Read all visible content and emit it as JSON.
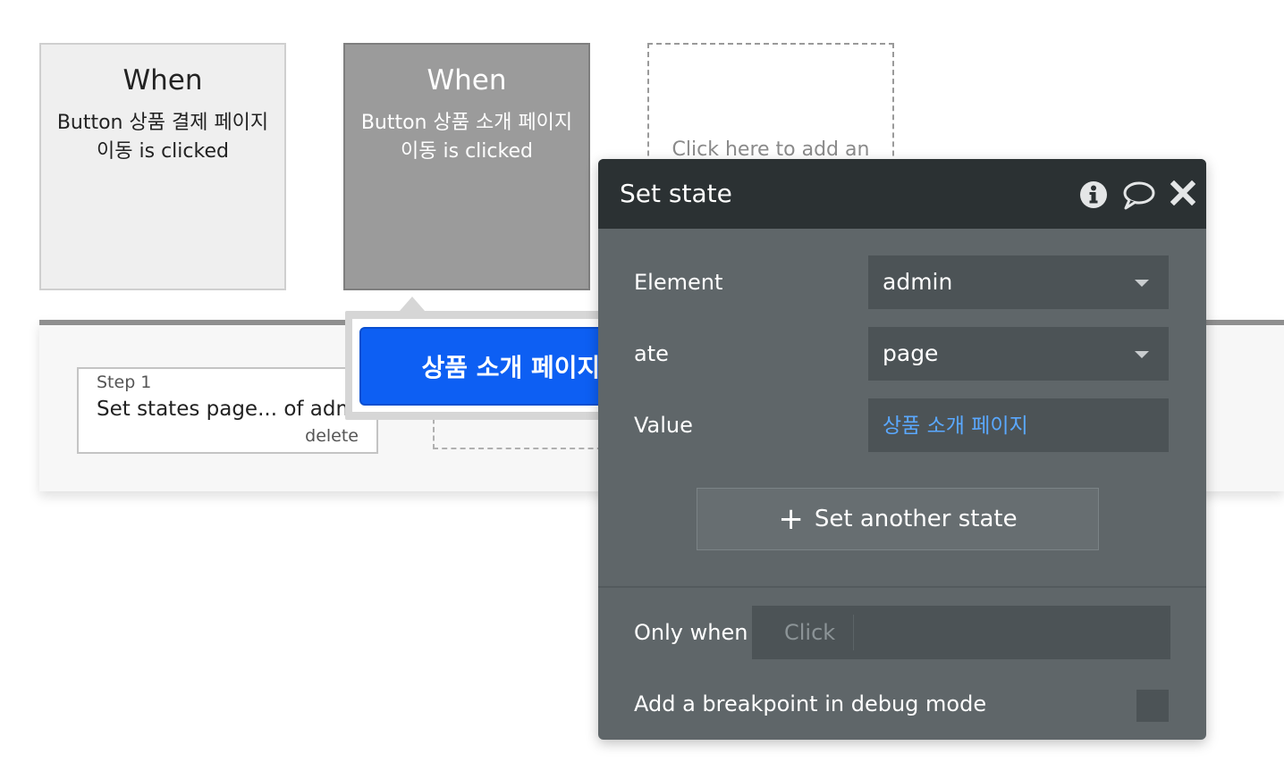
{
  "events": [
    {
      "title": "When",
      "description": "Button 상품 결제 페이지 이동 is clicked"
    },
    {
      "title": "When",
      "description": "Button 상품 소개 페이지 이동 is clicked"
    }
  ],
  "add_event_text": "Click here to add an",
  "step": {
    "label": "Step 1",
    "text": "Set states page... of admi",
    "delete_label": "delete"
  },
  "tooltip": {
    "button_label": "상품 소개 페이지 이동"
  },
  "panel": {
    "title": "Set state",
    "element_label": "Element",
    "element_value": "admin",
    "state_label_partial": "ate",
    "state_value": "page",
    "value_label_partial": "Value",
    "value_value": "상품 소개 페이지",
    "set_another_label": "Set another state",
    "only_when_label": "Only when",
    "only_when_placeholder": "Click",
    "breakpoint_label": "Add a breakpoint in debug mode"
  },
  "icons": {
    "info": "info-icon",
    "comment": "comment-icon",
    "close": "close-icon",
    "plus": "plus-icon"
  },
  "colors": {
    "accent_button": "#0d5ff3",
    "panel_bg": "#5f6669",
    "panel_header": "#2b3133",
    "value_text": "#5aa8ff"
  }
}
